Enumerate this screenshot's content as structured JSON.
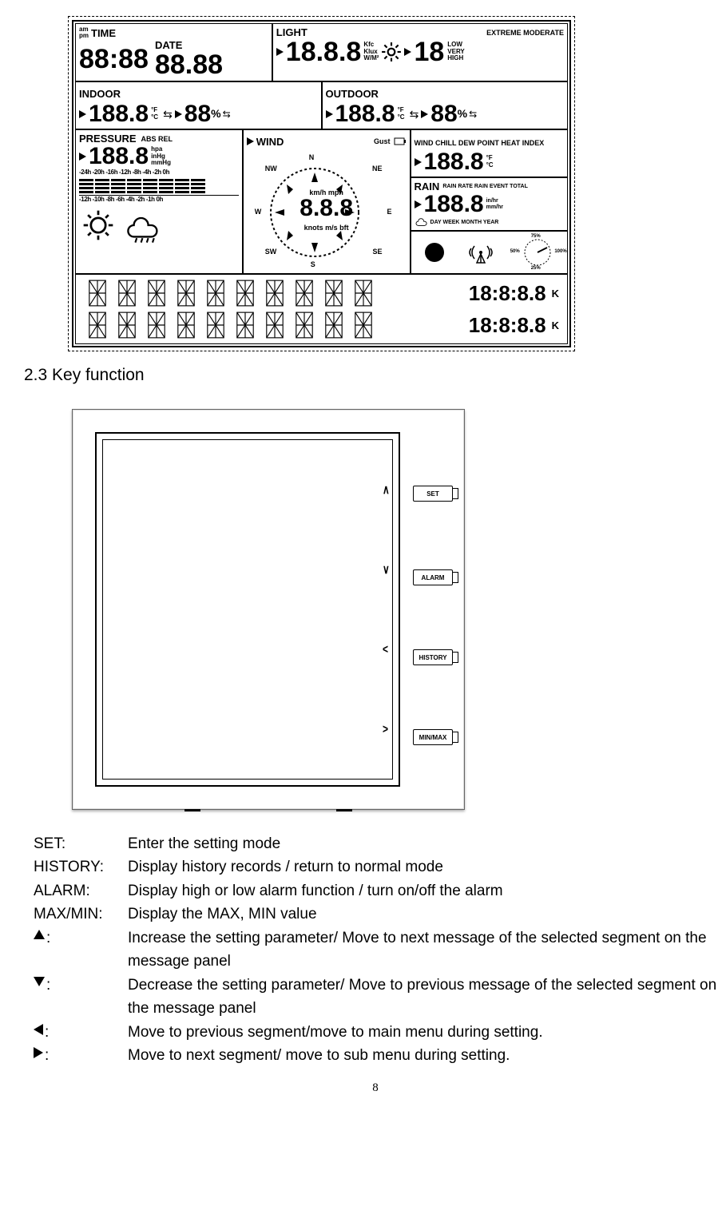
{
  "lcd": {
    "row1": {
      "time": {
        "label": "TIME",
        "ampm_top": "am",
        "ampm_bot": "pm",
        "value": "88:88"
      },
      "date": {
        "label": "DATE",
        "value": "88.88"
      },
      "light": {
        "label": "LIGHT",
        "value": "18.8.8",
        "units": [
          "Kfc",
          "Klux",
          "W/M²"
        ],
        "right_levels_top": "EXTREME MODERATE",
        "right_levels": [
          "LOW",
          "VERY",
          "HIGH"
        ],
        "uv_value": "18"
      }
    },
    "row2": {
      "indoor": {
        "label": "INDOOR",
        "value": "188.8",
        "temp_units_top": "°F",
        "temp_units_bot": "°C",
        "hum_value": "88",
        "hum_unit": "%"
      },
      "outdoor": {
        "label": "OUTDOOR",
        "value": "188.8",
        "temp_units_top": "°F",
        "temp_units_bot": "°C",
        "hum_value": "88",
        "hum_unit": "%"
      }
    },
    "row3": {
      "pressure": {
        "label": "PRESSURE",
        "mode": "ABS REL",
        "value": "188.8",
        "units": [
          "hpa",
          "inHg",
          "mmHg"
        ],
        "scale_top": "-24h -20h -16h -12h -8h  -4h  -2h  0h",
        "scale_bot": "-12h -10h -8h  -6h -4h  -2h  -1h  0h"
      },
      "wind": {
        "label": "WIND",
        "gust_label": "Gust",
        "value": "8.8.8",
        "dirs": {
          "n": "N",
          "ne": "NE",
          "e": "E",
          "se": "SE",
          "s": "S",
          "sw": "SW",
          "w": "W",
          "nw": "NW"
        },
        "speed_units_top": "km/h mph",
        "speed_units_bot": "knots m/s bft"
      },
      "chill": {
        "label": "WIND CHILL DEW POINT HEAT INDEX",
        "value": "188.8",
        "temp_units_top": "°F",
        "temp_units_bot": "°C"
      },
      "rain": {
        "label": "RAIN",
        "modes": "RAIN RATE RAIN EVENT TOTAL",
        "value": "188.8",
        "units_top": "in/hr",
        "units_bot": "mm/hr",
        "period": "DAY WEEK MONTH YEAR"
      },
      "signal": {
        "pct_top": "75%",
        "pct_left": "50%",
        "pct_right": "100%",
        "pct_bot": "25%"
      }
    },
    "msg": {
      "time1": "18:8:8.8",
      "unit1": "K",
      "time2": "18:8:8.8",
      "unit2": "K"
    }
  },
  "section_heading": "2.3 Key function",
  "device": {
    "buttons": [
      "SET",
      "ALARM",
      "HISTORY",
      "MIN/MAX"
    ],
    "left_arrows": [
      "∧",
      "∨",
      "<",
      ">"
    ]
  },
  "keys": [
    {
      "name": "SET:",
      "desc": "Enter the setting mode"
    },
    {
      "name": "HISTORY:",
      "desc": "Display history records / return to normal mode"
    },
    {
      "name": "ALARM:",
      "desc": "Display high or low alarm function / turn on/off the alarm"
    },
    {
      "name": "MAX/MIN:",
      "desc": "Display the MAX, MIN value"
    },
    {
      "icon": "up",
      "desc": "Increase the setting parameter/ Move to next message of the selected segment on the message panel"
    },
    {
      "icon": "down",
      "desc": "Decrease the setting parameter/ Move to previous message of the selected segment on the message panel"
    },
    {
      "icon": "left",
      "desc": "Move to previous segment/move to main menu during setting."
    },
    {
      "icon": "right",
      "desc": "Move to next segment/ move to sub menu during setting."
    }
  ],
  "page_number": "8"
}
